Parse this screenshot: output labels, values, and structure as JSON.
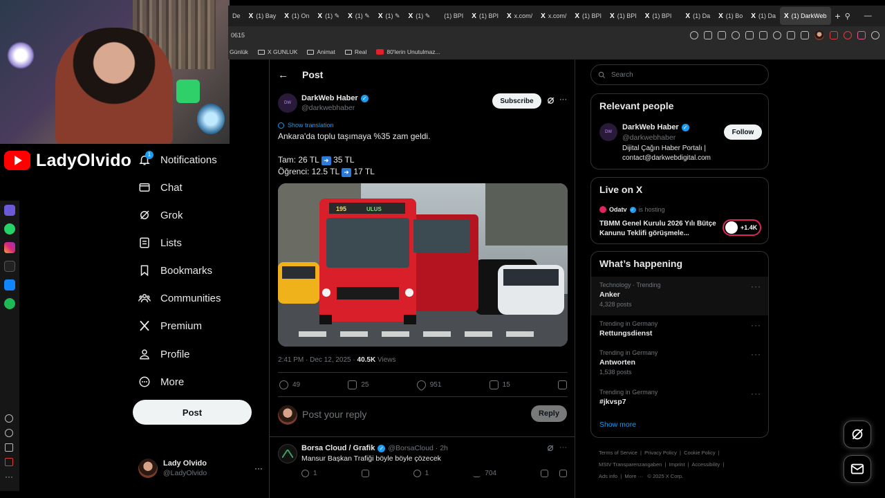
{
  "browser": {
    "tabs": [
      {
        "label": "De"
      },
      {
        "label": "(1) Bay"
      },
      {
        "label": "(1) On"
      },
      {
        "label": "(1) ✎"
      },
      {
        "label": "(1) ✎"
      },
      {
        "label": "(1) ✎"
      },
      {
        "label": "(1) ✎"
      },
      {
        "label": "(1) BPI"
      },
      {
        "label": "(1) BPI"
      },
      {
        "label": "x.com/"
      },
      {
        "label": "x.com/"
      },
      {
        "label": "(1) BPI"
      },
      {
        "label": "(1) BPI"
      },
      {
        "label": "(1) BPI"
      },
      {
        "label": "(1) Da"
      },
      {
        "label": "(1) Bo"
      },
      {
        "label": "(1) Da"
      },
      {
        "label": "(1) DarkWeb"
      }
    ],
    "url": "0615",
    "bookmarks": [
      "Günlük",
      "X GUNLUK",
      "Animat",
      "Real",
      "80'lerin Unutulmaz..."
    ]
  },
  "stream": {
    "channel_name": "LadyOlvido"
  },
  "nav": {
    "notifications": "Notifications",
    "notifications_badge": "1",
    "chat": "Chat",
    "grok": "Grok",
    "lists": "Lists",
    "bookmarks": "Bookmarks",
    "communities": "Communities",
    "premium": "Premium",
    "profile": "Profile",
    "more": "More",
    "post_button": "Post"
  },
  "account": {
    "name": "Lady Olvido",
    "handle": "@LadyOlvido"
  },
  "post_header": {
    "title": "Post"
  },
  "tweet": {
    "author": "DarkWeb Haber",
    "handle": "@darkwebhaber",
    "subscribe": "Subscribe",
    "show_translation": "Show translation",
    "line1": "Ankara'da toplu taşımaya %35 zam geldi.",
    "fare_full_label": "Tam: 26 TL",
    "fare_full_new": "35 TL",
    "fare_student_label": "Öğrenci: 12.5 TL",
    "fare_student_new": "17 TL",
    "bus_route": "195",
    "bus_destination": "ULUS",
    "timestamp": "2:41 PM · Dec 12, 2025 · ",
    "views": "40.5K",
    "views_label": "Views",
    "replies": "49",
    "reposts": "25",
    "likes": "951",
    "bookmarks": "15",
    "reply_placeholder": "Post your reply",
    "reply_button": "Reply"
  },
  "reply_tweet": {
    "author": "Borsa Cloud / Grafik",
    "handle": "@BorsaCloud · 2h",
    "text": "Mansur Başkan Trafiği böyle böyle çözecek",
    "replies": "1",
    "likes": "1",
    "views": "704"
  },
  "sidebar": {
    "search_placeholder": "Search",
    "relevant_title": "Relevant people",
    "relevant_name": "DarkWeb Haber",
    "relevant_handle": "@darkwebhaber",
    "relevant_bio": "Dijital Çağın Haber Portalı | contact@darkwebdigital.com",
    "follow": "Follow",
    "live_title": "Live on X",
    "live_host": "Odatv",
    "live_hosting": "is hosting",
    "live_text": "TBMM Genel Kurulu 2026 Yılı Bütçe Kanunu Teklifi görüşmele...",
    "live_count": "+1.4K",
    "happening_title": "What’s happening",
    "trends": [
      {
        "meta": "Technology · Trending",
        "topic": "Anker",
        "count": "4,328 posts"
      },
      {
        "meta": "Trending in Germany",
        "topic": "Rettungsdienst",
        "count": ""
      },
      {
        "meta": "Trending in Germany",
        "topic": "Antworten",
        "count": "1,538 posts"
      },
      {
        "meta": "Trending in Germany",
        "topic": "#jkvsp7",
        "count": ""
      }
    ],
    "show_more": "Show more"
  },
  "footer": {
    "links": [
      "Terms of Service",
      "Privacy Policy",
      "Cookie Policy",
      "MStV Transparenzangaben",
      "Imprint",
      "Accessibility",
      "Ads info",
      "More ···",
      "© 2025 X Corp."
    ]
  },
  "colors": {
    "accent": "#1d9bf0",
    "background": "#000000",
    "border": "#2f3336",
    "youtube_red": "#ff0000",
    "bus_red": "#d9202a"
  }
}
